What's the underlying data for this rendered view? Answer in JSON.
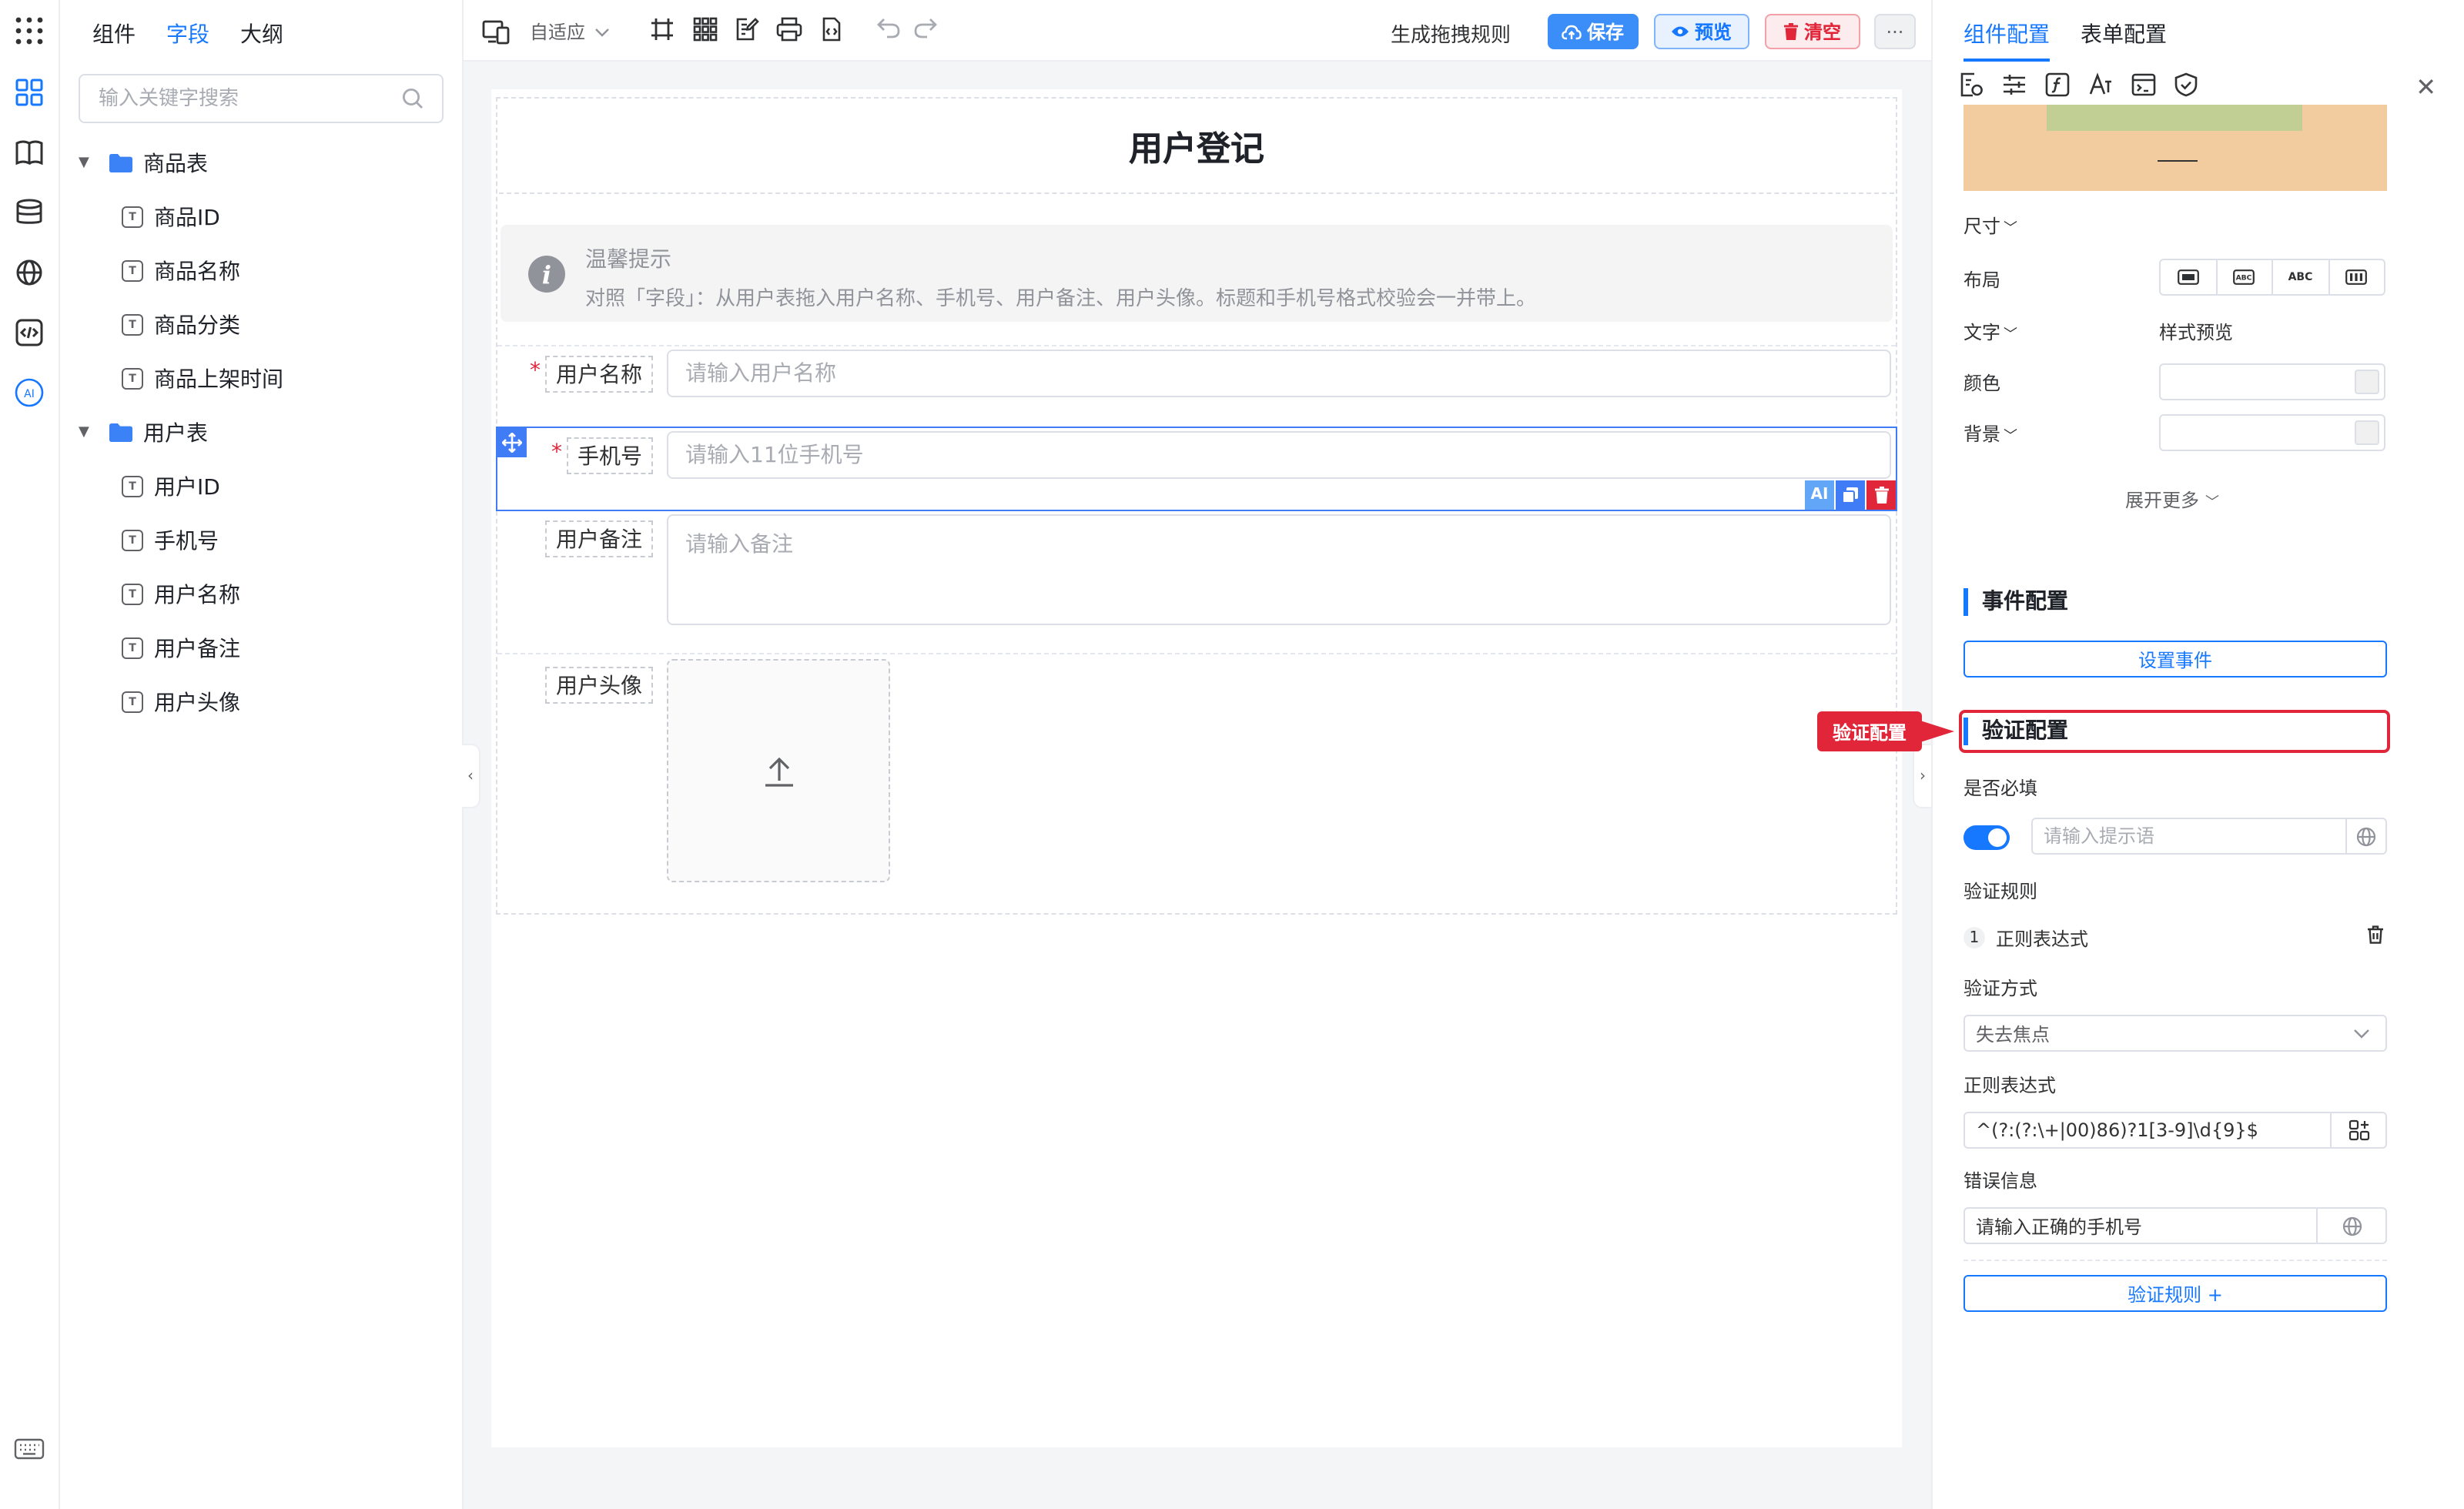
{
  "left_panel": {
    "tabs": [
      "组件",
      "字段",
      "大纲"
    ],
    "active_tab": "字段",
    "search_placeholder": "输入关键字搜索",
    "tree": [
      {
        "label": "商品表",
        "children": [
          "商品ID",
          "商品名称",
          "商品分类",
          "商品上架时间"
        ]
      },
      {
        "label": "用户表",
        "children": [
          "用户ID",
          "手机号",
          "用户名称",
          "用户备注",
          "用户头像"
        ]
      }
    ]
  },
  "toolbar": {
    "adapt_label": "自适应",
    "generate_rules": "生成拖拽规则",
    "save_label": "保存",
    "preview_label": "预览",
    "clear_label": "清空",
    "more_label": "···"
  },
  "form": {
    "title": "用户登记",
    "tip_title": "温馨提示",
    "tip_text": "对照「字段」：从用户表拖入用户名称、手机号、用户备注、用户头像。标题和手机号格式校验会一并带上。",
    "fields": [
      {
        "label": "用户名称",
        "placeholder": "请输入用户名称",
        "required": "*"
      },
      {
        "label": "手机号",
        "placeholder": "请输入11位手机号",
        "required": "*"
      },
      {
        "label": "用户备注",
        "placeholder": "请输入备注"
      },
      {
        "label": "用户头像"
      }
    ],
    "ai_action": "AI"
  },
  "right_panel": {
    "tabs": [
      "组件配置",
      "表单配置"
    ],
    "active_tab": "组件配置",
    "size_label": "尺寸",
    "layout_label": "布局",
    "layout_options": [
      "",
      "ABC",
      "ABC",
      ""
    ],
    "text_label": "文字",
    "style_preview": "样式预览",
    "color_label": "颜色",
    "bg_label": "背景",
    "expand_more": "展开更多",
    "event_section": "事件配置",
    "set_event": "设置事件",
    "validation_section": "验证配置",
    "callout": "验证配置",
    "required_label": "是否必填",
    "required_on": true,
    "hint_placeholder": "请输入提示语",
    "rules_label": "验证规则",
    "rule_index": "1",
    "rule_name": "正则表达式",
    "method_label": "验证方式",
    "method_value": "失去焦点",
    "regex_label": "正则表达式",
    "regex_value": "^(?:(?:\\+|00)86)?1[3-9]\\d{9}$",
    "error_label": "错误信息",
    "error_value": "请输入正确的手机号",
    "add_rule": "验证规则 +"
  },
  "colors": {
    "accent": "#1677ff",
    "danger": "#e2263a",
    "preview_outer": "#f2cc9e",
    "preview_inner": "#c2cf94"
  }
}
